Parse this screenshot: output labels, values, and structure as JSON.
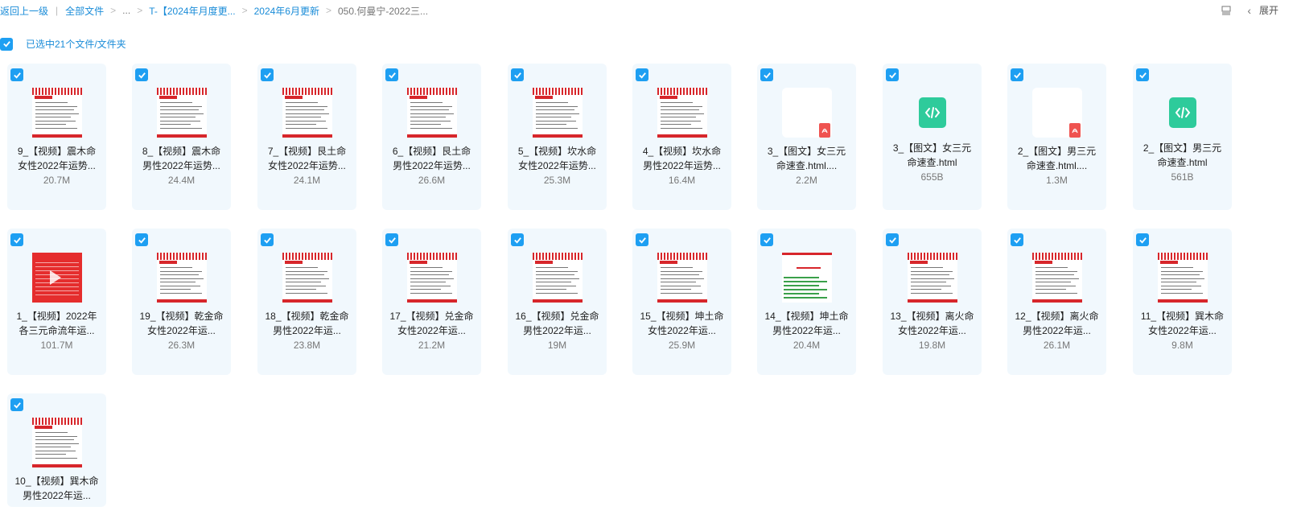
{
  "breadcrumb": {
    "back": "返回上一级",
    "all_files": "全部文件",
    "ellipsis": "...",
    "folder1": "T-【2024年月度更...",
    "folder2": "2024年6月更新",
    "current": "050.何曼宁-2022三..."
  },
  "toolbar": {
    "expand": "展开"
  },
  "selection": {
    "label": "已选中21个文件/文件夹"
  },
  "colors": {
    "accent": "#1e9ff2",
    "link": "#1a8cd8",
    "card_bg": "#f1f8fd",
    "pdf": "#ef5350",
    "html": "#2ecb9b"
  },
  "files": [
    {
      "name_l1": "9_【视频】震木命",
      "name_l2": "女性2022年运势...",
      "size": "20.7M",
      "thumb": "doc"
    },
    {
      "name_l1": "8_【视频】震木命",
      "name_l2": "男性2022年运势...",
      "size": "24.4M",
      "thumb": "doc"
    },
    {
      "name_l1": "7_【视频】艮土命",
      "name_l2": "女性2022年运势...",
      "size": "24.1M",
      "thumb": "doc"
    },
    {
      "name_l1": "6_【视频】艮土命",
      "name_l2": "男性2022年运势...",
      "size": "26.6M",
      "thumb": "doc"
    },
    {
      "name_l1": "5_【视频】坎水命",
      "name_l2": "女性2022年运势...",
      "size": "25.3M",
      "thumb": "doc"
    },
    {
      "name_l1": "4_【视频】坎水命",
      "name_l2": "男性2022年运势...",
      "size": "16.4M",
      "thumb": "doc"
    },
    {
      "name_l1": "3_【图文】女三元",
      "name_l2": "命速查.html....",
      "size": "2.2M",
      "thumb": "pdf"
    },
    {
      "name_l1": "3_【图文】女三元",
      "name_l2": "命速查.html",
      "size": "655B",
      "thumb": "html"
    },
    {
      "name_l1": "2_【图文】男三元",
      "name_l2": "命速查.html....",
      "size": "1.3M",
      "thumb": "pdf"
    },
    {
      "name_l1": "2_【图文】男三元",
      "name_l2": "命速查.html",
      "size": "561B",
      "thumb": "html"
    },
    {
      "name_l1": "1_【视频】2022年",
      "name_l2": "各三元命流年运...",
      "size": "101.7M",
      "thumb": "red"
    },
    {
      "name_l1": "19_【视频】乾金命",
      "name_l2": "女性2022年运...",
      "size": "26.3M",
      "thumb": "doc"
    },
    {
      "name_l1": "18_【视频】乾金命",
      "name_l2": "男性2022年运...",
      "size": "23.8M",
      "thumb": "doc"
    },
    {
      "name_l1": "17_【视频】兑金命",
      "name_l2": "女性2022年运...",
      "size": "21.2M",
      "thumb": "doc"
    },
    {
      "name_l1": "16_【视频】兑金命",
      "name_l2": "男性2022年运...",
      "size": "19M",
      "thumb": "doc"
    },
    {
      "name_l1": "15_【视频】坤土命",
      "name_l2": "女性2022年运...",
      "size": "25.9M",
      "thumb": "doc"
    },
    {
      "name_l1": "14_【视频】坤土命",
      "name_l2": "男性2022年运...",
      "size": "20.4M",
      "thumb": "green"
    },
    {
      "name_l1": "13_【视频】离火命",
      "name_l2": "女性2022年运...",
      "size": "19.8M",
      "thumb": "doc"
    },
    {
      "name_l1": "12_【视频】离火命",
      "name_l2": "男性2022年运...",
      "size": "26.1M",
      "thumb": "doc"
    },
    {
      "name_l1": "11_【视频】巽木命",
      "name_l2": "女性2022年运...",
      "size": "9.8M",
      "thumb": "doc"
    },
    {
      "name_l1": "10_【视频】巽木命",
      "name_l2": "男性2022年运...",
      "size": "",
      "thumb": "doc"
    }
  ]
}
